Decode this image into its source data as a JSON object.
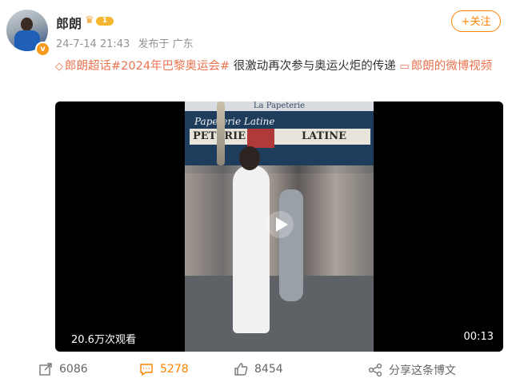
{
  "post": {
    "username": "郎朗",
    "level": "1",
    "timestamp": "24-7-14 21:43",
    "source": "发布于 广东",
    "follow_label": "+关注",
    "verified_mark": "v"
  },
  "content": {
    "super_topic": "郎朗超话",
    "hashtag": "#2024年巴黎奥运会#",
    "text": " 很激动再次参与奥运火炬的传递 ",
    "video_link": "郎朗的微博视频"
  },
  "video": {
    "view_count": "20.6万次观看",
    "duration": "00:13",
    "scene_sign_top": "La Papeterie",
    "scene_sign_script": "Papeterie Latine",
    "scene_sign_left": "PETERIE",
    "scene_sign_right": "LATINE"
  },
  "actions": {
    "share_count": "6086",
    "comment_count": "5278",
    "like_count": "8454",
    "share_label": "分享这条博文"
  },
  "colors": {
    "accent": "#ff8200",
    "link": "#eb7350",
    "muted": "#939393"
  }
}
